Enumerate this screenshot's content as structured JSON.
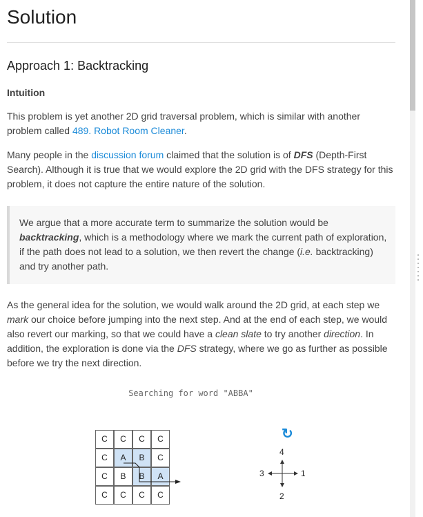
{
  "page_title": "Solution",
  "approach_title": "Approach 1: Backtracking",
  "intuition_heading": "Intuition",
  "p1": {
    "text_before": "This problem is yet another 2D grid traversal problem, which is similar with another problem called ",
    "link": "489. Robot Room Cleaner",
    "text_after": "."
  },
  "p2": {
    "t1": "Many people in the ",
    "link": "discussion forum",
    "t2": " claimed that the solution is of ",
    "dfs": "DFS",
    "t3": " (Depth-First Search). Although it is true that we would explore the 2D grid with the DFS strategy for this problem, it does not capture the entire nature of the solution."
  },
  "quote": {
    "t1": "We argue that a more accurate term to summarize the solution would be ",
    "backtracking": "backtracking",
    "t2": ", which is a methodology where we mark the current path of exploration, if the path does not lead to a solution, we then revert the change (",
    "ie": "i.e.",
    "t3": " backtracking) and try another path."
  },
  "p3": {
    "t1": "As the general idea for the solution, we would walk around the 2D grid, at each step we ",
    "mark": "mark",
    "t2": " our choice before jumping into the next step. And at the end of each step, we would also revert our marking, so that we could have a ",
    "clean_slate": "clean slate",
    "t3": " to try another ",
    "direction": "direction",
    "t4": ". In addition, the exploration is done via the ",
    "dfs": "DFS",
    "t5": " strategy, where we go as further as possible before we try the next direction."
  },
  "figure": {
    "caption": "Searching for word \"ABBA\"",
    "grid": [
      [
        "C",
        "C",
        "C",
        "C"
      ],
      [
        "C",
        "A",
        "B",
        "C"
      ],
      [
        "C",
        "B",
        "B",
        "A"
      ],
      [
        "C",
        "C",
        "C",
        "C"
      ]
    ],
    "highlighted": [
      [
        1,
        1
      ],
      [
        1,
        2
      ],
      [
        2,
        2
      ],
      [
        2,
        3
      ]
    ],
    "compass_labels": {
      "up": "4",
      "right": "1",
      "down": "2",
      "left": "3"
    },
    "refresh_icon": "refresh-icon"
  }
}
